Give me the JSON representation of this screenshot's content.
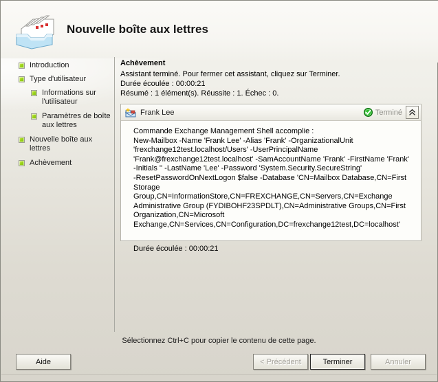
{
  "window": {
    "title": "Nouvelle boîte aux lettres",
    "banner_icon": "mailbox-stack-icon"
  },
  "sidebar": {
    "items": [
      {
        "label": "Introduction",
        "level": 0,
        "bullet": "green-square-icon"
      },
      {
        "label": "Type d'utilisateur",
        "level": 0,
        "bullet": "green-square-icon"
      },
      {
        "label": "Informations sur l'utilisateur",
        "level": 1,
        "bullet": "green-square-icon"
      },
      {
        "label": "Paramètres de boîte aux lettres",
        "level": 1,
        "bullet": "green-square-icon"
      },
      {
        "label": "Nouvelle boîte aux lettres",
        "level": 0,
        "bullet": "green-square-icon"
      },
      {
        "label": "Achèvement",
        "level": 0,
        "bullet": "green-square-icon"
      }
    ]
  },
  "content": {
    "heading": "Achèvement",
    "description": "Assistant terminé. Pour fermer cet assistant, cliquez sur Terminer.",
    "elapsed": "Durée écoulée : 00:00:21",
    "summary": "Résumé : 1 élément(s). Réussite : 1. Échec : 0."
  },
  "result_panel": {
    "icon": "new-mailbox-icon",
    "name": "Frank Lee",
    "status_icon": "green-check-circle-icon",
    "status_text": "Terminé",
    "collapse_icon": "chevron-double-up-icon",
    "body": "Commande Exchange Management Shell accomplie :\nNew-Mailbox -Name 'Frank Lee' -Alias 'Frank' -OrganizationalUnit\n'frexchange12test.localhost/Users' -UserPrincipalName\n'Frank@frexchange12test.localhost' -SamAccountName 'Frank' -FirstName 'Frank'\n-Initials '' -LastName 'Lee' -Password 'System.Security.SecureString'\n-ResetPasswordOnNextLogon $false -Database 'CN=Mailbox Database,CN=First\nStorage Group,CN=InformationStore,CN=FREXCHANGE,CN=Servers,CN=Exchange\nAdministrative Group (FYDIBOHF23SPDLT),CN=Administrative Groups,CN=First\nOrganization,CN=Microsoft\nExchange,CN=Services,CN=Configuration,DC=frexchange12test,DC=localhost'",
    "elapsed": "Durée écoulée : 00:00:21"
  },
  "footer": {
    "hint": "Sélectionnez Ctrl+C pour copier le contenu de cette page.",
    "buttons": {
      "help": "Aide",
      "back": "< Précédent",
      "finish": "Terminer",
      "cancel": "Annuler"
    }
  },
  "colors": {
    "accent_green": "#9ed41c",
    "status_green": "#1fa220",
    "window_bg": "#e8e6de",
    "panel_bg": "#fdfdfa"
  }
}
